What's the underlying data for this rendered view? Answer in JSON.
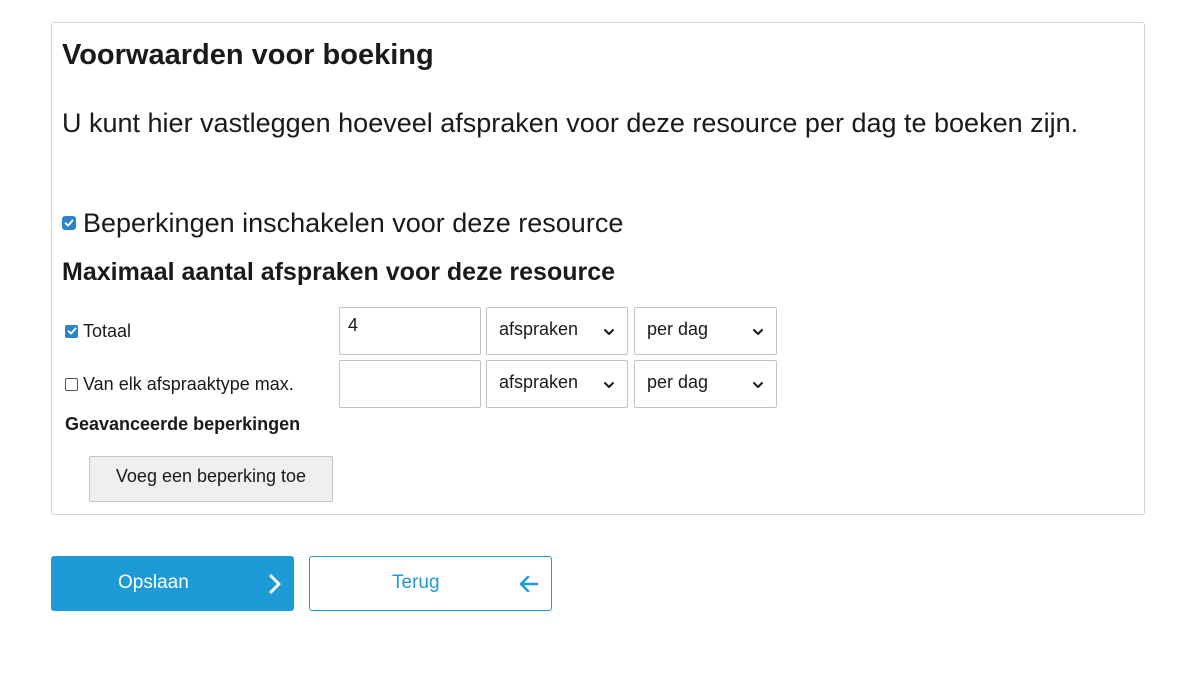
{
  "section": {
    "title": "Voorwaarden voor boeking",
    "intro": "U kunt hier vastleggen hoeveel afspraken voor deze resource per dag te boeken zijn.",
    "enable_label": "Beperkingen inschakelen voor deze resource",
    "enable_checked": true,
    "subtitle": "Maximaal aantal afspraken voor deze resource"
  },
  "limits": {
    "total": {
      "label": "Totaal",
      "checked": true,
      "value": "4",
      "unit": "afspraken",
      "period": "per dag"
    },
    "each_type": {
      "label": "Van elk afspraaktype max.",
      "checked": false,
      "value": "",
      "unit": "afspraken",
      "period": "per dag"
    }
  },
  "advanced": {
    "title": "Geavanceerde beperkingen",
    "add_button": "Voeg een beperking toe"
  },
  "actions": {
    "save_label": "Opslaan",
    "back_label": "Terug",
    "save_icon": "chevron-right-icon",
    "back_icon": "arrow-left-icon"
  },
  "colors": {
    "primary": "#1e9ad6",
    "checkbox": "#2a86c8",
    "border": "#d4d4d4"
  }
}
